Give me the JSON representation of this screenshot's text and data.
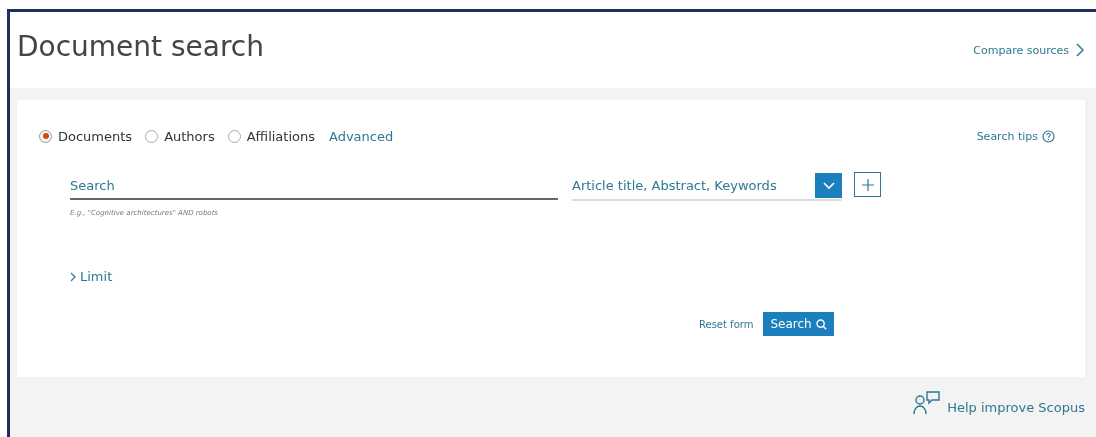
{
  "header": {
    "title": "Document search",
    "compare_link": "Compare sources"
  },
  "search_form": {
    "search_types": [
      {
        "label": "Documents",
        "selected": true
      },
      {
        "label": "Authors",
        "selected": false
      },
      {
        "label": "Affiliations",
        "selected": false
      }
    ],
    "advanced_link": "Advanced",
    "search_tips": "Search tips",
    "search_field": {
      "placeholder": "Search",
      "hint": "E.g., \"Cognitive architectures\" AND robots"
    },
    "field_select": {
      "value": "Article title, Abstract, Keywords"
    },
    "limit": "Limit",
    "reset": "Reset form",
    "search_button": "Search"
  },
  "footer": {
    "help_link": "Help improve Scopus"
  }
}
